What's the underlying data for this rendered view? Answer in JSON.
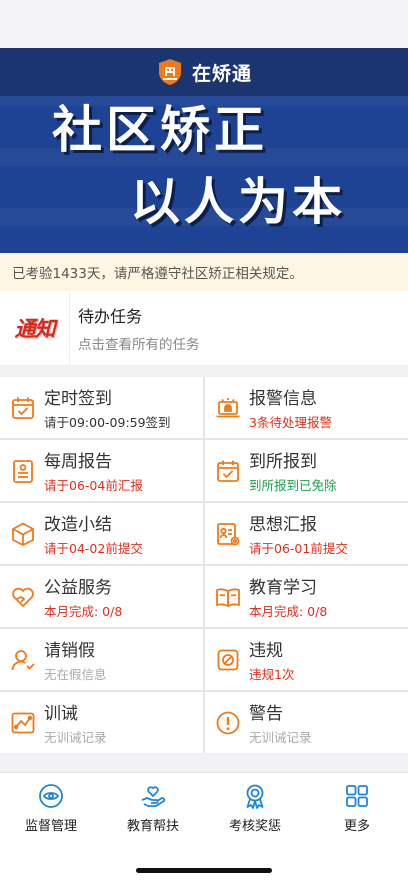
{
  "app": {
    "title": "在矫通"
  },
  "banner": {
    "line1": "社区矫正",
    "line2": "以人为本"
  },
  "notice": "已考验1433天，请严格遵守社区矫正相关规定。",
  "task": {
    "badge": "通知",
    "title": "待办任务",
    "subtitle": "点击查看所有的任务"
  },
  "grid": [
    {
      "icon": "calendar-check-icon",
      "title": "定时签到",
      "sub": "请于09:00-09:59签到",
      "sub_color": "dark"
    },
    {
      "icon": "alarm-laptop-icon",
      "title": "报警信息",
      "sub": "3条待处理报警",
      "sub_color": "red"
    },
    {
      "icon": "report-icon",
      "title": "每周报告",
      "sub": "请于06-04前汇报",
      "sub_color": "red"
    },
    {
      "icon": "calendar-check-icon",
      "title": "到所报到",
      "sub": "到所报到已免除",
      "sub_color": "green"
    },
    {
      "icon": "cube-icon",
      "title": "改造小结",
      "sub": "请于04-02前提交",
      "sub_color": "red"
    },
    {
      "icon": "thought-report-icon",
      "title": "思想汇报",
      "sub": "请于06-01前提交",
      "sub_color": "red"
    },
    {
      "icon": "hand-heart-icon",
      "title": "公益服务",
      "sub": "本月完成: 0/8",
      "sub_color": "red"
    },
    {
      "icon": "book-icon",
      "title": "教育学习",
      "sub": "本月完成: 0/8",
      "sub_color": "red"
    },
    {
      "icon": "user-leave-icon",
      "title": "请销假",
      "sub": "无在假信息",
      "sub_color": "gray"
    },
    {
      "icon": "violation-icon",
      "title": "违规",
      "sub": "违规1次",
      "sub_color": "red"
    },
    {
      "icon": "trend-icon",
      "title": "训诫",
      "sub": "无训诫记录",
      "sub_color": "gray"
    },
    {
      "icon": "warning-icon",
      "title": "警告",
      "sub": "无训诫记录",
      "sub_color": "gray"
    }
  ],
  "tabs": [
    {
      "icon": "eye-icon",
      "label": "监督管理"
    },
    {
      "icon": "hand-heart-icon",
      "label": "教育帮扶"
    },
    {
      "icon": "award-icon",
      "label": "考核奖惩"
    },
    {
      "icon": "grid-icon",
      "label": "更多"
    }
  ],
  "colors": {
    "accent_orange": "#f07a1a",
    "tab_blue": "#1f86d6",
    "header_navy": "#1b3570",
    "banner_blue": "#1e4394"
  }
}
